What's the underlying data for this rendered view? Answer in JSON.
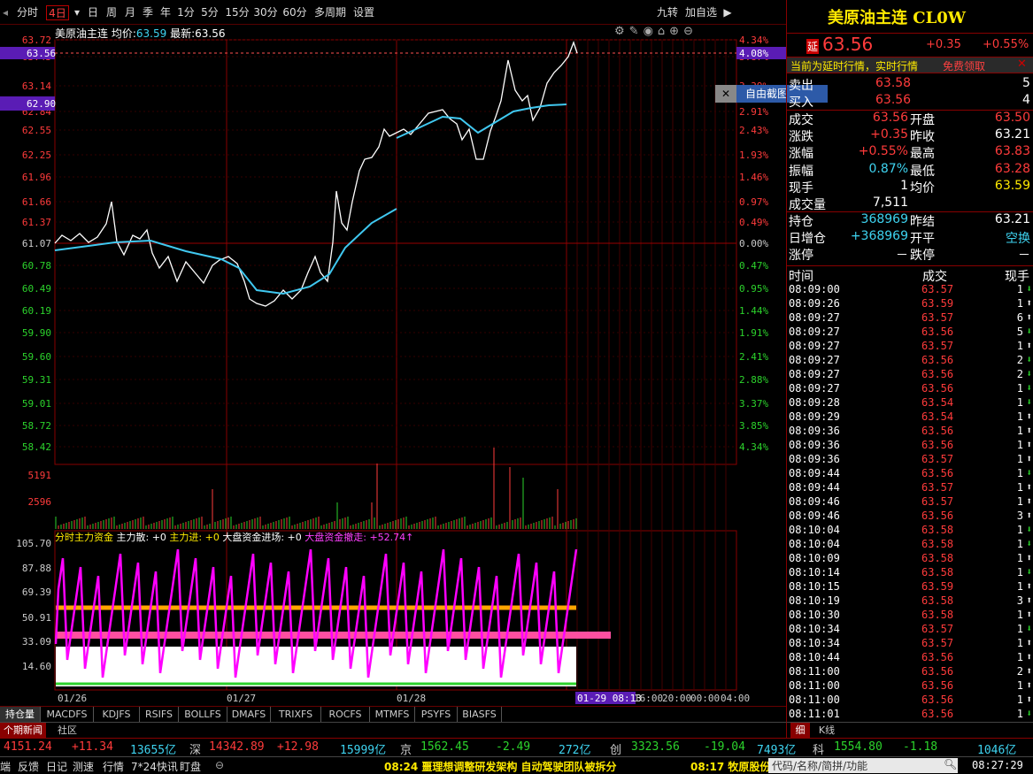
{
  "toolbar": {
    "items": [
      "分时",
      "4日",
      "日",
      "周",
      "月",
      "季",
      "年",
      "1分",
      "5分",
      "15分",
      "30分",
      "60分",
      "多周期",
      "设置"
    ],
    "active": "4日",
    "right": [
      "九转",
      "加自选"
    ]
  },
  "chart_header": {
    "name": "美原油主连",
    "avg_label": "均价:",
    "avg": "63.59",
    "last_label": "最新:",
    "last": "63.56"
  },
  "y_prices": [
    "63.72",
    "63.43",
    "63.14",
    "62.84",
    "62.55",
    "62.25",
    "61.96",
    "61.66",
    "61.37",
    "61.07",
    "60.78",
    "60.49",
    "60.19",
    "59.90",
    "59.60",
    "59.31",
    "59.01",
    "58.72",
    "58.42"
  ],
  "y_pct": [
    "4.34%",
    "3.87%",
    "3.39%",
    "2.91%",
    "2.43%",
    "1.93%",
    "1.46%",
    "0.97%",
    "0.49%",
    "0.00%",
    "0.47%",
    "0.95%",
    "1.44%",
    "1.91%",
    "2.41%",
    "2.88%",
    "3.37%",
    "3.85%",
    "4.34%"
  ],
  "price_markers": {
    "current": "63.56",
    "current_pct": "4.08%",
    "hover": "62.90"
  },
  "vol_labels": [
    "5191",
    "2596"
  ],
  "ind_header": {
    "title": "分时主力资金",
    "f1": "主力散: +0",
    "f2": "主力进: +0",
    "f3": "大盘资金进场: +0",
    "f4": "大盘资金撤走: +52.74↑"
  },
  "ind_labels": [
    "105.70",
    "87.88",
    "69.39",
    "50.91",
    "33.09",
    "14.60"
  ],
  "x_dates": [
    "01/26",
    "01/27",
    "01/28",
    "01-29 08:13",
    "16:00",
    "20:00",
    "00:00",
    "04:00"
  ],
  "tooltip": "自由截图",
  "right": {
    "title": "美原油主连 CL0W",
    "delay_tag": "延",
    "price": "63.56",
    "chg": "+0.35",
    "pct": "+0.55%",
    "notice": "当前为延时行情，实时行情",
    "notice_link": "免费领取",
    "ask_label": "卖出",
    "ask": "63.58",
    "ask_vol": "5",
    "bid_label": "买入",
    "bid": "63.56",
    "bid_vol": "4",
    "stats": [
      [
        "成交",
        "63.56",
        "开盘",
        "63.50"
      ],
      [
        "涨跌",
        "+0.35",
        "昨收",
        "63.21"
      ],
      [
        "涨幅",
        "+0.55%",
        "最高",
        "63.83"
      ],
      [
        "振幅",
        "0.87%",
        "最低",
        "63.28"
      ],
      [
        "现手",
        "1",
        "均价",
        "63.59"
      ],
      [
        "成交量",
        "7,511",
        "",
        ""
      ],
      [
        "持仓",
        "368969",
        "昨结",
        "63.21"
      ],
      [
        "日增仓",
        "+368969",
        "开平",
        "空换"
      ],
      [
        "涨停",
        "－",
        "跌停",
        "－"
      ]
    ],
    "ticks_header": [
      "时间",
      "成交",
      "现手"
    ],
    "ticks": [
      [
        "08:09:00",
        "63.57",
        "1"
      ],
      [
        "08:09:26",
        "63.59",
        "1"
      ],
      [
        "08:09:27",
        "63.57",
        "6"
      ],
      [
        "08:09:27",
        "63.56",
        "5"
      ],
      [
        "08:09:27",
        "63.57",
        "1"
      ],
      [
        "08:09:27",
        "63.56",
        "2"
      ],
      [
        "08:09:27",
        "63.56",
        "2"
      ],
      [
        "08:09:27",
        "63.56",
        "1"
      ],
      [
        "08:09:28",
        "63.54",
        "1"
      ],
      [
        "08:09:29",
        "63.54",
        "1"
      ],
      [
        "08:09:36",
        "63.56",
        "1"
      ],
      [
        "08:09:36",
        "63.56",
        "1"
      ],
      [
        "08:09:36",
        "63.57",
        "1"
      ],
      [
        "08:09:44",
        "63.56",
        "1"
      ],
      [
        "08:09:44",
        "63.57",
        "1"
      ],
      [
        "08:09:46",
        "63.57",
        "1"
      ],
      [
        "08:09:46",
        "63.56",
        "3"
      ],
      [
        "08:10:04",
        "63.58",
        "1"
      ],
      [
        "08:10:04",
        "63.58",
        "1"
      ],
      [
        "08:10:09",
        "63.58",
        "1"
      ],
      [
        "08:10:14",
        "63.58",
        "1"
      ],
      [
        "08:10:15",
        "63.59",
        "1"
      ],
      [
        "08:10:19",
        "63.58",
        "3"
      ],
      [
        "08:10:30",
        "63.58",
        "1"
      ],
      [
        "08:10:34",
        "63.57",
        "1"
      ],
      [
        "08:10:34",
        "63.57",
        "1"
      ],
      [
        "08:10:44",
        "63.56",
        "1"
      ],
      [
        "08:11:00",
        "63.56",
        "2"
      ],
      [
        "08:11:00",
        "63.56",
        "1"
      ],
      [
        "08:11:00",
        "63.56",
        "1"
      ],
      [
        "08:11:01",
        "63.56",
        "1"
      ]
    ],
    "tick_dirs": [
      "down",
      "up",
      "up",
      "down",
      "up",
      "down",
      "down",
      "down",
      "down",
      "up",
      "up",
      "up",
      "up",
      "down",
      "up",
      "up",
      "up",
      "down",
      "down",
      "up",
      "down",
      "up",
      "up",
      "up",
      "down",
      "up",
      "up",
      "up",
      "up",
      "up",
      "down"
    ],
    "bottom_tabs": [
      "细",
      "K线"
    ]
  },
  "bottom_tabs": [
    "持仓量",
    "MACDFS",
    "KDJFS",
    "RSIFS",
    "BOLLFS",
    "DMAFS",
    "TRIXFS",
    "ROCFS",
    "MTMFS",
    "PSYFS",
    "BIASFS"
  ],
  "left_tabs": [
    "个期新闻",
    "社区"
  ],
  "index_bar": [
    {
      "v": "4151.24",
      "c": "#ff3b3b"
    },
    {
      "v": "+11.34",
      "c": "#ff3b3b"
    },
    {
      "v": "13655亿",
      "c": "#3ed3f0"
    },
    {
      "v": "深",
      "c": "#ccc"
    },
    {
      "v": "14342.89",
      "c": "#ff3b3b"
    },
    {
      "v": "+12.98",
      "c": "#ff3b3b"
    },
    {
      "v": "15999亿",
      "c": "#3ed3f0"
    },
    {
      "v": "京",
      "c": "#ccc"
    },
    {
      "v": "1562.45",
      "c": "#2cd32c"
    },
    {
      "v": "-2.49",
      "c": "#2cd32c"
    },
    {
      "v": "272亿",
      "c": "#3ed3f0"
    },
    {
      "v": "创",
      "c": "#ccc"
    },
    {
      "v": "3323.56",
      "c": "#2cd32c"
    },
    {
      "v": "-19.04",
      "c": "#2cd32c"
    },
    {
      "v": "7493亿",
      "c": "#3ed3f0"
    },
    {
      "v": "科",
      "c": "#ccc"
    },
    {
      "v": "1554.80",
      "c": "#2cd32c"
    },
    {
      "v": "-1.18",
      "c": "#2cd32c"
    },
    {
      "v": "1046亿",
      "c": "#3ed3f0"
    }
  ],
  "status": {
    "items": [
      "端",
      "反馈",
      "日记",
      "测速",
      "行情",
      "7*24快讯",
      "盯盘"
    ],
    "news1": "08:24 噩理想调整研发架构 自动驾驶团队被拆分",
    "news2": "08:17 牧原股份",
    "search_placeholder": "代码/名称/简拼/功能",
    "clock": "08:27:29"
  }
}
